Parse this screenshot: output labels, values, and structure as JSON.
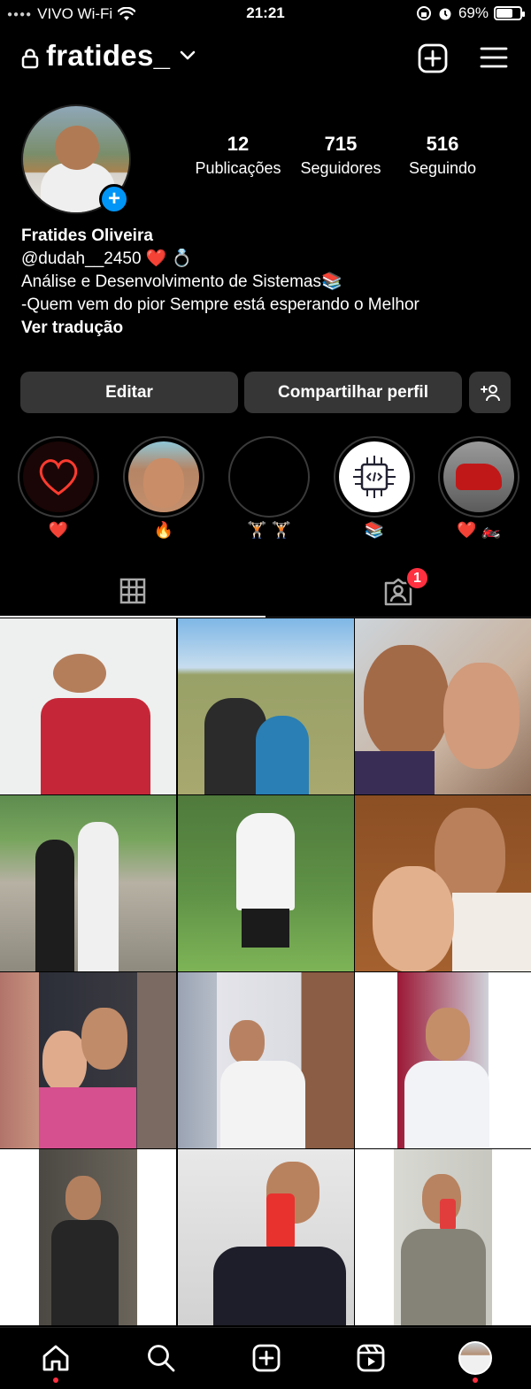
{
  "status_bar": {
    "carrier": "VIVO Wi-Fi",
    "time": "21:21",
    "battery": "69%",
    "battery_level": 0.69
  },
  "header": {
    "username": "fratides_"
  },
  "profile": {
    "stats": [
      {
        "value": "12",
        "label": "Publicações"
      },
      {
        "value": "715",
        "label": "Seguidores"
      },
      {
        "value": "516",
        "label": "Seguindo"
      }
    ],
    "name": "Fratides Oliveira",
    "bio_lines": [
      "@dudah__2450 ❤️ 💍",
      "Análise e Desenvolvimento de Sistemas📚",
      "-Quem vem do pior Sempre está esperando o Melhor"
    ],
    "translate_label": "Ver tradução"
  },
  "actions": {
    "edit": "Editar",
    "share": "Compartilhar perfil"
  },
  "highlights": [
    {
      "label": "❤️",
      "icon": "heart-icon"
    },
    {
      "label": "🔥",
      "icon": "selfie-photo"
    },
    {
      "label": "🏋🏻 🏋🏻",
      "icon": "black-circle"
    },
    {
      "label": "📚",
      "icon": "chip-code-icon"
    },
    {
      "label": "❤️ 🏍️",
      "icon": "motorcycle-photo"
    }
  ],
  "tabs": {
    "tagged_badge": "1"
  },
  "colors": {
    "accent": "#0095f6",
    "badge": "#ff3040",
    "button_bg": "#363636"
  }
}
